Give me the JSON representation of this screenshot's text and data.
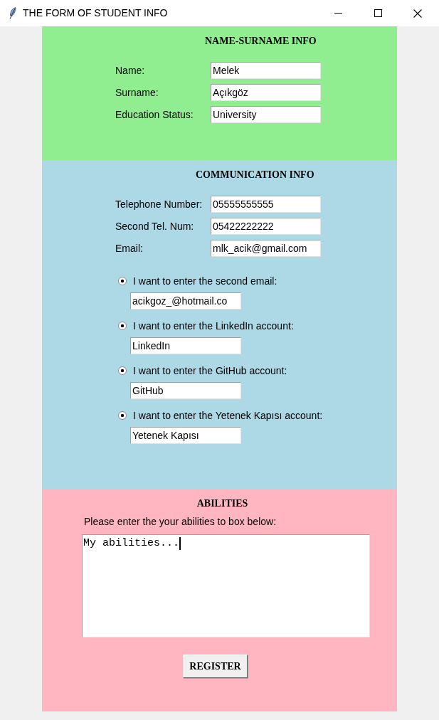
{
  "window": {
    "title": "THE FORM OF STUDENT INFO"
  },
  "name_section": {
    "heading": "NAME-SURNAME INFO",
    "fields": [
      {
        "label": "Name:",
        "value": "Melek"
      },
      {
        "label": "Surname:",
        "value": "Açıkgöz"
      },
      {
        "label": "Education Status:",
        "value": "University"
      }
    ]
  },
  "communication_section": {
    "heading": "COMMUNICATION INFO",
    "fields": [
      {
        "label": "Telephone Number:",
        "value": "05555555555"
      },
      {
        "label": "Second Tel. Num:",
        "value": "05422222222"
      },
      {
        "label": "Email:",
        "value": "mlk_acik@gmail.com"
      }
    ],
    "options": [
      {
        "label": "I want to enter the second email:",
        "selected": true,
        "value": "acikgoz_@hotmail.co"
      },
      {
        "label": "I want to enter the LinkedIn account:",
        "selected": true,
        "value": "LinkedIn"
      },
      {
        "label": "I want to enter the GitHub account:",
        "selected": true,
        "value": "GitHub"
      },
      {
        "label": "I want to enter the Yetenek Kapısı account:",
        "selected": true,
        "value": "Yetenek Kapısı"
      }
    ]
  },
  "abilities_section": {
    "heading": "ABILITIES",
    "prompt": "Please enter the your abilities to box below:",
    "text": "My abilities...",
    "button": "REGISTER"
  }
}
